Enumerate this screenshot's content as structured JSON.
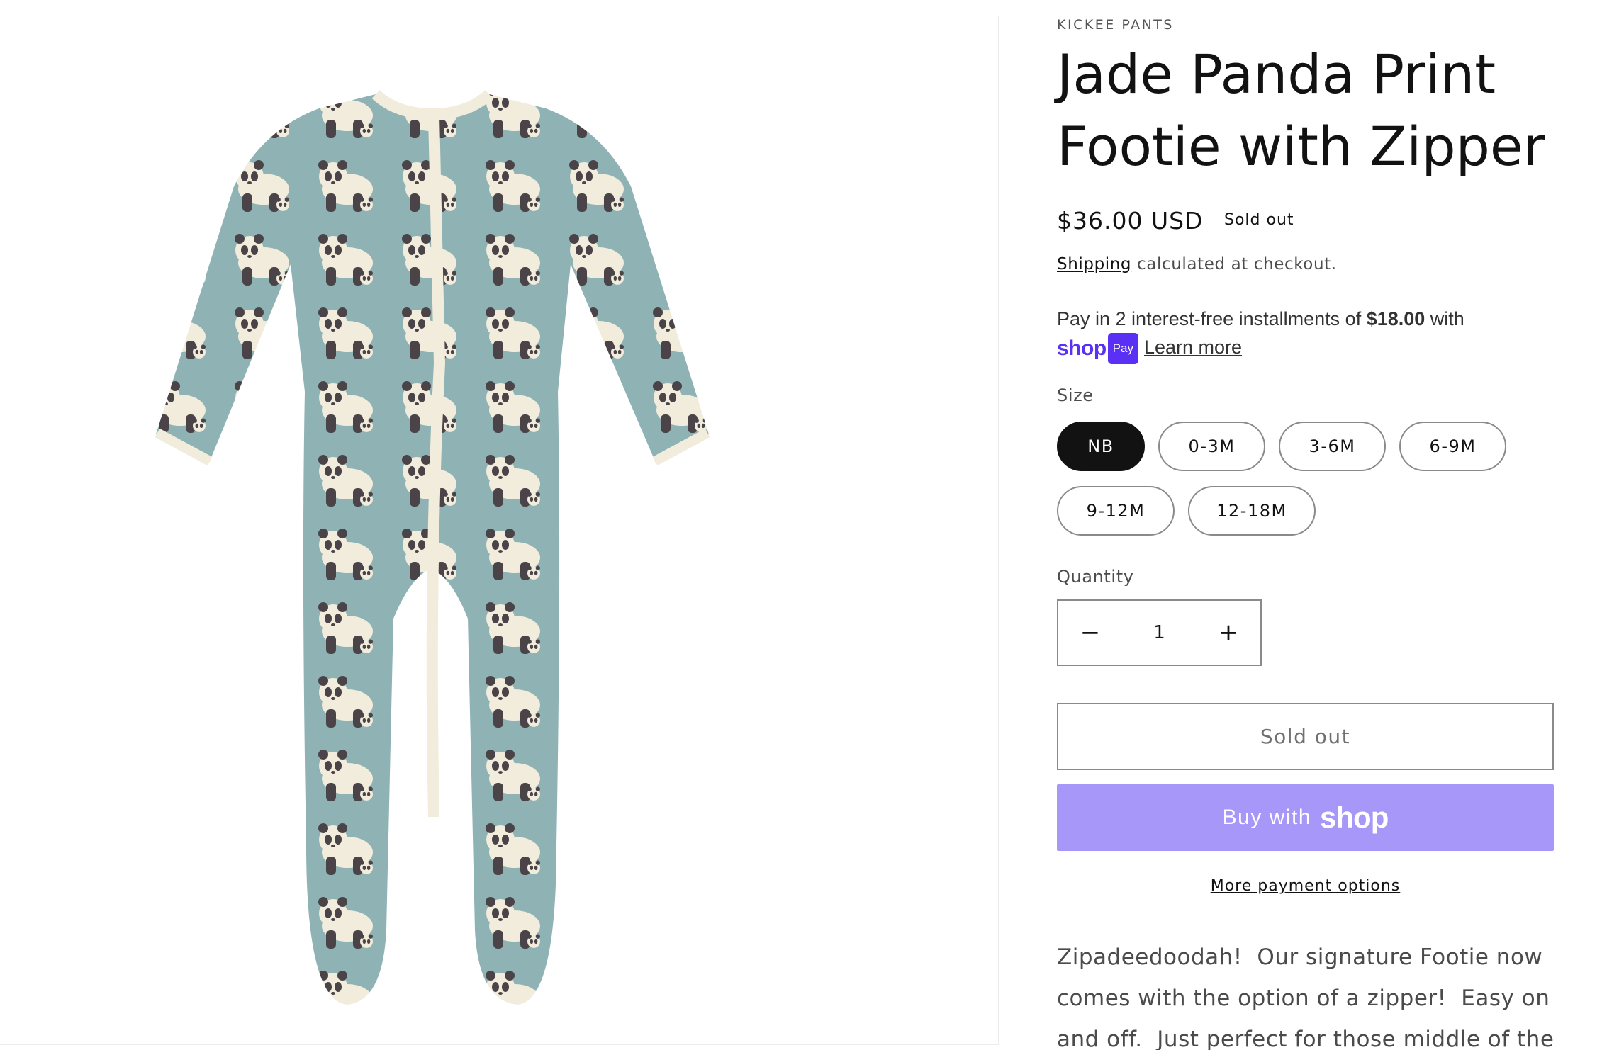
{
  "product": {
    "vendor": "KICKEE PANTS",
    "title": "Jade Panda Print Footie with Zipper",
    "price": "$36.00 USD",
    "badge": "Sold out",
    "shipping_link": "Shipping",
    "shipping_rest": " calculated at checkout.",
    "image_alt": "Jade Panda Print Footie with Zipper"
  },
  "installments": {
    "text_before": "Pay in 2 interest-free installments of ",
    "amount": "$18.00",
    "text_after": " with",
    "shop_logo": "shop",
    "pay_tag": "Pay",
    "learn_more": "Learn more"
  },
  "size": {
    "label": "Size",
    "options": [
      "NB",
      "0-3M",
      "3-6M",
      "6-9M",
      "9-12M",
      "12-18M"
    ],
    "selected": "NB"
  },
  "quantity": {
    "label": "Quantity",
    "value": "1",
    "minus": "−",
    "plus": "+"
  },
  "buttons": {
    "sold_out": "Sold out",
    "buy_with": "Buy with",
    "buy_shop": "shop",
    "more_options": "More payment options"
  },
  "description": "Zipadeedoodah!  Our signature Footie now comes with the option of a zipper!  Easy on and off.  Just perfect for those middle of the night",
  "colors": {
    "fabric": "#8fb3b5",
    "trim": "#f1ecdc",
    "panda_dark": "#4a4448",
    "shop_purple": "#5a31f4",
    "buy_button": "#a797f8"
  }
}
